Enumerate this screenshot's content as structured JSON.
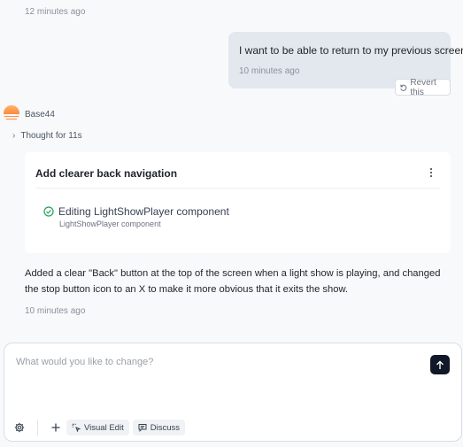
{
  "history": {
    "first_timestamp": "12 minutes ago"
  },
  "user_message": {
    "text": "I want to be able to return to my previous screen",
    "timestamp": "10 minutes ago",
    "revert_label": "Revert this"
  },
  "agent": {
    "name": "Base44",
    "thought_label": "Thought for 11s",
    "card": {
      "title": "Add clearer back navigation",
      "step_label": "Editing LightShowPlayer component",
      "step_sub": "LightShowPlayer component"
    },
    "reply": "Added a clear \"Back\" button at the top of the screen when a light show is playing, and changed the stop button icon to an X to make it more obvious that it exits the show.",
    "timestamp": "10 minutes ago"
  },
  "composer": {
    "placeholder": "What would you like to change?",
    "visual_edit_label": "Visual Edit",
    "discuss_label": "Discuss"
  },
  "colors": {
    "send_button": "#111827",
    "user_bubble": "#e3e8ef",
    "success": "#22a35a",
    "avatar": "#ff8a3d"
  }
}
